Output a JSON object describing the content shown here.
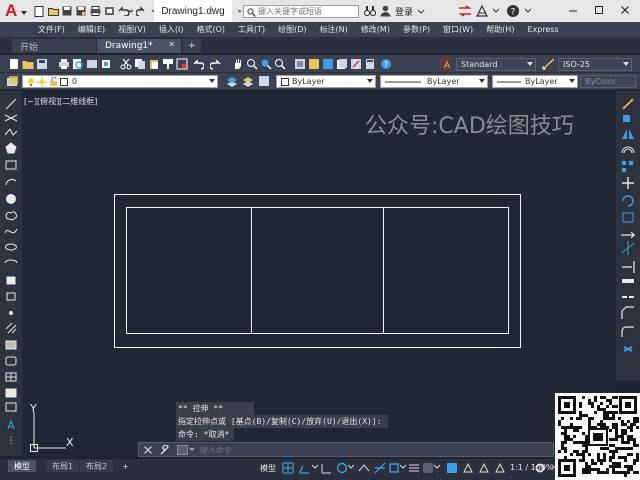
{
  "titlebar": {
    "document_title": "Drawing1.dwg",
    "search_placeholder": "键入关键字或短语",
    "signin_label": "登录",
    "icons": [
      "app-logo",
      "new-icon",
      "open-icon",
      "save-icon",
      "saveas-icon",
      "print-icon",
      "undo-icon",
      "redo-icon",
      "search-icon",
      "user-icon",
      "exchange-icon",
      "help-icon",
      "minimize-icon",
      "maximize-icon",
      "close-icon"
    ]
  },
  "menu": {
    "items": [
      "文件(F)",
      "编辑(E)",
      "视图(V)",
      "插入(I)",
      "格式(O)",
      "工具(T)",
      "绘图(D)",
      "标注(N)",
      "修改(M)",
      "参数(P)",
      "窗口(W)",
      "帮助(H)",
      "Express"
    ]
  },
  "tabs": {
    "start": "开始",
    "drawing": "Drawing1*",
    "add": "+"
  },
  "toolbar1": {
    "text_style": "Standard",
    "dim_style": "ISO-25"
  },
  "toolbar2": {
    "layer": "0",
    "color": "ByLayer",
    "linetype": "ByLayer",
    "lineweight": "ByLayer",
    "plotstyle": "ByColor"
  },
  "canvas": {
    "view_label": "[−][俯视][二维线框]",
    "watermark": "公众号:CAD绘图技巧",
    "ucs_x": "X",
    "ucs_y": "Y"
  },
  "command": {
    "history": [
      "** 拉伸 **",
      "指定拉伸点或 [基点(B)/复制(C)/放弃(U)/退出(X)]:",
      "命令: *取消*"
    ],
    "input_placeholder": "键入命令"
  },
  "statusbar": {
    "model_tab": "模型",
    "layout1": "布局1",
    "layout2": "布局2",
    "add": "+",
    "model_label": "模型",
    "scale": "1:1 / 100%"
  },
  "colors": {
    "canvas_bg": "#212733",
    "accent_blue": "#3aa0e8",
    "logo_red": "#d11919"
  }
}
